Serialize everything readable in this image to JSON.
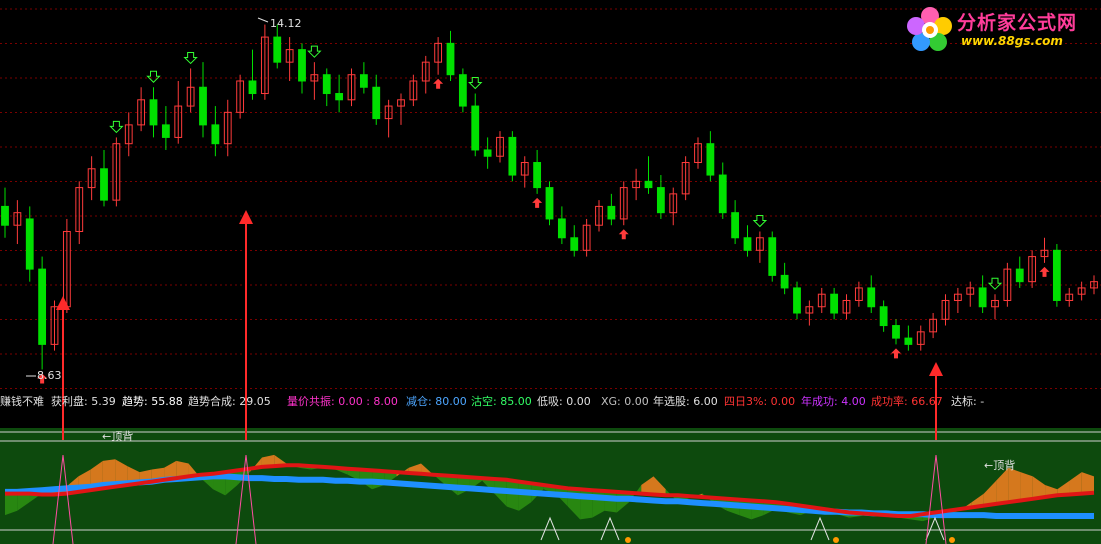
{
  "logo": {
    "title": "分析家公式网",
    "url": "www.88gs.com"
  },
  "info_bar": [
    {
      "key": "title",
      "text": "赚钱不难",
      "color": "#e0e0e0"
    },
    {
      "key": "profit",
      "text": "获利盘: 5.39",
      "color": "#e0e0e0"
    },
    {
      "key": "trend",
      "text": "趋势: 55.88",
      "color": "#ffffff"
    },
    {
      "key": "trend_comb",
      "text": "趋势合成: 29.05",
      "color": "#e0e0e0"
    },
    {
      "key": "vol_price",
      "text": "量价共振: 0.00 : 8.00",
      "color": "#ff33cc"
    },
    {
      "key": "reduce",
      "text": "减仓: 80.00",
      "color": "#4da6ff"
    },
    {
      "key": "clear",
      "text": "沽空: 85.00",
      "color": "#33ff66"
    },
    {
      "key": "low_buy",
      "text": "低吸: 0.00",
      "color": "#e0e0e0"
    },
    {
      "key": "xg",
      "text": "XG: 0.00",
      "color": "#c0c0c0"
    },
    {
      "key": "year_pick",
      "text": "年选股: 6.00",
      "color": "#e0e0e0"
    },
    {
      "key": "four_day",
      "text": "四日3%: 0.00",
      "color": "#ff3333"
    },
    {
      "key": "year_success",
      "text": "年成功: 4.00",
      "color": "#cc33ff"
    },
    {
      "key": "success_rate",
      "text": "成功率: 66.67",
      "color": "#ff3333"
    },
    {
      "key": "target",
      "text": "达标: -",
      "color": "#e0e0e0"
    }
  ],
  "colors": {
    "up": "#ff3b3b",
    "down": "#00e000",
    "grid": "#7a0000",
    "arrow": "#ff2a2a",
    "panel_bg": "#0d4a0d",
    "band_border": "#d0d0d0"
  },
  "chart_data": {
    "type": "candlestick",
    "high_label": "14.12",
    "low_label": "8.63",
    "candles": [
      [
        11.2,
        11.5,
        10.7,
        10.9
      ],
      [
        10.9,
        11.3,
        10.6,
        11.1
      ],
      [
        11.0,
        11.2,
        10.0,
        10.2
      ],
      [
        10.2,
        10.4,
        8.6,
        9.0
      ],
      [
        9.0,
        9.7,
        8.9,
        9.6
      ],
      [
        9.6,
        11.0,
        9.5,
        10.8
      ],
      [
        10.8,
        11.6,
        10.6,
        11.5
      ],
      [
        11.5,
        12.0,
        11.3,
        11.8
      ],
      [
        11.8,
        12.1,
        11.2,
        11.3
      ],
      [
        11.3,
        12.3,
        11.2,
        12.2
      ],
      [
        12.2,
        12.7,
        12.0,
        12.5
      ],
      [
        12.5,
        13.1,
        12.4,
        12.9
      ],
      [
        12.9,
        13.1,
        12.3,
        12.5
      ],
      [
        12.5,
        12.8,
        12.1,
        12.3
      ],
      [
        12.3,
        13.2,
        12.2,
        12.8
      ],
      [
        12.8,
        13.4,
        12.7,
        13.1
      ],
      [
        13.1,
        13.5,
        12.3,
        12.5
      ],
      [
        12.5,
        12.8,
        12.0,
        12.2
      ],
      [
        12.2,
        12.9,
        12.0,
        12.7
      ],
      [
        12.7,
        13.3,
        12.6,
        13.2
      ],
      [
        13.2,
        13.7,
        12.9,
        13.0
      ],
      [
        13.0,
        14.1,
        12.9,
        13.9
      ],
      [
        13.9,
        14.1,
        13.4,
        13.5
      ],
      [
        13.5,
        13.9,
        13.2,
        13.7
      ],
      [
        13.7,
        13.8,
        13.0,
        13.2
      ],
      [
        13.2,
        13.5,
        12.9,
        13.3
      ],
      [
        13.3,
        13.4,
        12.8,
        13.0
      ],
      [
        13.0,
        13.3,
        12.7,
        12.9
      ],
      [
        12.9,
        13.4,
        12.8,
        13.3
      ],
      [
        13.3,
        13.5,
        13.0,
        13.1
      ],
      [
        13.1,
        13.3,
        12.5,
        12.6
      ],
      [
        12.6,
        12.9,
        12.3,
        12.8
      ],
      [
        12.8,
        13.0,
        12.5,
        12.9
      ],
      [
        12.9,
        13.3,
        12.8,
        13.2
      ],
      [
        13.2,
        13.6,
        13.0,
        13.5
      ],
      [
        13.5,
        13.9,
        13.3,
        13.8
      ],
      [
        13.8,
        14.0,
        13.2,
        13.3
      ],
      [
        13.3,
        13.4,
        12.7,
        12.8
      ],
      [
        12.8,
        13.0,
        12.0,
        12.1
      ],
      [
        12.1,
        12.3,
        11.8,
        12.0
      ],
      [
        12.0,
        12.4,
        11.9,
        12.3
      ],
      [
        12.3,
        12.4,
        11.6,
        11.7
      ],
      [
        11.7,
        12.0,
        11.5,
        11.9
      ],
      [
        11.9,
        12.1,
        11.4,
        11.5
      ],
      [
        11.5,
        11.6,
        10.9,
        11.0
      ],
      [
        11.0,
        11.2,
        10.6,
        10.7
      ],
      [
        10.7,
        10.9,
        10.4,
        10.5
      ],
      [
        10.5,
        11.0,
        10.4,
        10.9
      ],
      [
        10.9,
        11.3,
        10.8,
        11.2
      ],
      [
        11.2,
        11.4,
        10.9,
        11.0
      ],
      [
        11.0,
        11.6,
        10.9,
        11.5
      ],
      [
        11.5,
        11.8,
        11.3,
        11.6
      ],
      [
        11.6,
        12.0,
        11.4,
        11.5
      ],
      [
        11.5,
        11.7,
        11.0,
        11.1
      ],
      [
        11.1,
        11.5,
        10.9,
        11.4
      ],
      [
        11.4,
        12.0,
        11.3,
        11.9
      ],
      [
        11.9,
        12.3,
        11.8,
        12.2
      ],
      [
        12.2,
        12.4,
        11.6,
        11.7
      ],
      [
        11.7,
        11.9,
        11.0,
        11.1
      ],
      [
        11.1,
        11.3,
        10.6,
        10.7
      ],
      [
        10.7,
        10.9,
        10.4,
        10.5
      ],
      [
        10.5,
        10.8,
        10.3,
        10.7
      ],
      [
        10.7,
        10.8,
        10.0,
        10.1
      ],
      [
        10.1,
        10.3,
        9.8,
        9.9
      ],
      [
        9.9,
        10.0,
        9.4,
        9.5
      ],
      [
        9.5,
        9.7,
        9.3,
        9.6
      ],
      [
        9.6,
        9.9,
        9.5,
        9.8
      ],
      [
        9.8,
        9.9,
        9.4,
        9.5
      ],
      [
        9.5,
        9.8,
        9.4,
        9.7
      ],
      [
        9.7,
        10.0,
        9.6,
        9.9
      ],
      [
        9.9,
        10.1,
        9.5,
        9.6
      ],
      [
        9.6,
        9.7,
        9.2,
        9.3
      ],
      [
        9.3,
        9.4,
        9.0,
        9.1
      ],
      [
        9.1,
        9.3,
        8.9,
        9.0
      ],
      [
        9.0,
        9.3,
        8.9,
        9.2
      ],
      [
        9.2,
        9.5,
        9.1,
        9.4
      ],
      [
        9.4,
        9.8,
        9.3,
        9.7
      ],
      [
        9.7,
        9.9,
        9.5,
        9.8
      ],
      [
        9.8,
        10.0,
        9.6,
        9.9
      ],
      [
        9.9,
        10.1,
        9.5,
        9.6
      ],
      [
        9.6,
        9.8,
        9.4,
        9.7
      ],
      [
        9.7,
        10.3,
        9.6,
        10.2
      ],
      [
        10.2,
        10.4,
        9.9,
        10.0
      ],
      [
        10.0,
        10.5,
        9.9,
        10.4
      ],
      [
        10.4,
        10.7,
        10.3,
        10.5
      ],
      [
        10.5,
        10.6,
        9.6,
        9.7
      ],
      [
        9.7,
        9.9,
        9.6,
        9.8
      ],
      [
        9.8,
        10.0,
        9.7,
        9.9
      ],
      [
        9.9,
        10.1,
        9.8,
        10.0
      ]
    ],
    "buy_arrows_bar_index": [
      3,
      21,
      84
    ],
    "sub_indicator": {
      "blue_line": [
        0.58,
        0.58,
        0.57,
        0.56,
        0.55,
        0.54,
        0.53,
        0.52,
        0.5,
        0.49,
        0.48,
        0.47,
        0.46,
        0.44,
        0.43,
        0.42,
        0.41,
        0.4,
        0.4,
        0.41,
        0.42,
        0.42,
        0.43,
        0.43,
        0.44,
        0.44,
        0.44,
        0.45,
        0.45,
        0.46,
        0.46,
        0.47,
        0.48,
        0.49,
        0.5,
        0.51,
        0.52,
        0.53,
        0.54,
        0.55,
        0.56,
        0.57,
        0.58,
        0.59,
        0.6,
        0.61,
        0.62,
        0.63,
        0.64,
        0.65,
        0.66,
        0.66,
        0.67,
        0.68,
        0.69,
        0.69,
        0.7,
        0.71,
        0.72,
        0.73,
        0.74,
        0.75,
        0.76,
        0.77,
        0.78,
        0.79,
        0.8,
        0.81,
        0.81,
        0.82,
        0.82,
        0.83,
        0.83,
        0.84,
        0.84,
        0.84,
        0.85,
        0.85,
        0.85,
        0.85,
        0.85,
        0.86,
        0.86,
        0.86,
        0.86,
        0.86,
        0.86,
        0.86,
        0.86,
        0.86
      ],
      "red_line": [
        0.6,
        0.6,
        0.6,
        0.61,
        0.61,
        0.6,
        0.58,
        0.56,
        0.54,
        0.52,
        0.5,
        0.48,
        0.46,
        0.44,
        0.42,
        0.4,
        0.38,
        0.37,
        0.35,
        0.33,
        0.31,
        0.29,
        0.28,
        0.27,
        0.27,
        0.28,
        0.29,
        0.3,
        0.31,
        0.32,
        0.33,
        0.34,
        0.35,
        0.36,
        0.37,
        0.38,
        0.39,
        0.4,
        0.41,
        0.42,
        0.43,
        0.44,
        0.46,
        0.48,
        0.5,
        0.52,
        0.54,
        0.55,
        0.56,
        0.57,
        0.58,
        0.59,
        0.6,
        0.61,
        0.62,
        0.62,
        0.63,
        0.64,
        0.65,
        0.66,
        0.67,
        0.68,
        0.69,
        0.7,
        0.72,
        0.74,
        0.76,
        0.78,
        0.8,
        0.82,
        0.83,
        0.84,
        0.85,
        0.86,
        0.86,
        0.84,
        0.82,
        0.8,
        0.78,
        0.76,
        0.74,
        0.72,
        0.7,
        0.68,
        0.66,
        0.64,
        0.62,
        0.61,
        0.6,
        0.59
      ],
      "green_line": [
        0.85,
        0.8,
        0.7,
        0.6,
        0.55,
        0.52,
        0.4,
        0.32,
        0.22,
        0.2,
        0.28,
        0.35,
        0.32,
        0.3,
        0.22,
        0.25,
        0.42,
        0.55,
        0.62,
        0.5,
        0.35,
        0.18,
        0.15,
        0.25,
        0.3,
        0.32,
        0.3,
        0.32,
        0.38,
        0.45,
        0.55,
        0.5,
        0.4,
        0.3,
        0.25,
        0.38,
        0.5,
        0.62,
        0.55,
        0.45,
        0.6,
        0.75,
        0.8,
        0.7,
        0.55,
        0.6,
        0.75,
        0.9,
        0.88,
        0.8,
        0.82,
        0.7,
        0.5,
        0.4,
        0.55,
        0.7,
        0.65,
        0.6,
        0.72,
        0.8,
        0.85,
        0.9,
        0.85,
        0.78,
        0.82,
        0.85,
        0.8,
        0.76,
        0.84,
        0.88,
        0.86,
        0.82,
        0.85,
        0.88,
        0.9,
        0.92,
        0.88,
        0.85,
        0.8,
        0.7,
        0.6,
        0.45,
        0.3,
        0.35,
        0.4,
        0.5,
        0.55,
        0.45,
        0.35,
        0.4
      ]
    }
  }
}
